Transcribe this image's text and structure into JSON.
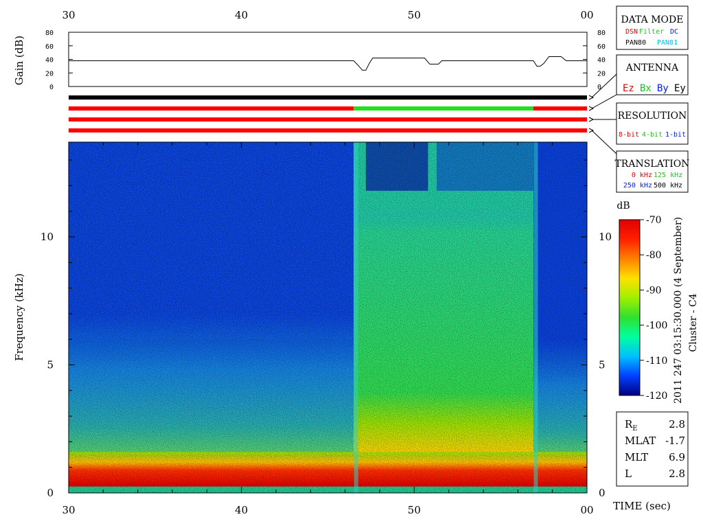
{
  "chart_data": [
    {
      "type": "line",
      "title": "",
      "ylabel": "Gain (dB)",
      "yticks": [
        "0",
        "20",
        "40",
        "60",
        "80"
      ],
      "ylim": [
        0,
        80
      ],
      "xlim": [
        30,
        60
      ],
      "xticks": [
        "30",
        "40",
        "50",
        "00"
      ],
      "series": [
        {
          "x": [
            30,
            46.5,
            46.8,
            47.0,
            47.2,
            47.4,
            47.6,
            50.6,
            50.9,
            51.4,
            51.6,
            56.9,
            57.1,
            57.3,
            57.5,
            57.8,
            58.5,
            58.8,
            60
          ],
          "y": [
            38,
            38,
            30,
            24,
            24,
            34,
            42,
            42,
            33,
            33,
            38,
            38,
            30,
            30,
            34,
            44,
            44,
            38,
            38
          ]
        }
      ]
    },
    {
      "type": "heatmap",
      "xlabel": "TIME (sec)",
      "ylabel": "Frequency (kHz)",
      "xlim": [
        30,
        60
      ],
      "ylim": [
        0,
        13.7
      ],
      "xticks": [
        "30",
        "40",
        "50",
        "00"
      ],
      "yticks": [
        "0",
        "5",
        "10"
      ],
      "colorbar": {
        "label": "dB",
        "range": [
          -120,
          -70
        ],
        "ticks": [
          "-70",
          "-80",
          "-90",
          "-100",
          "-110",
          "-120"
        ],
        "colors": [
          "#000080",
          "#0040ff",
          "#00c0ff",
          "#00ffa0",
          "#30e030",
          "#a0f000",
          "#ffe000",
          "#ff8000",
          "#ff2000",
          "#e00000"
        ]
      },
      "regions": [
        {
          "x": [
            30,
            46.5
          ],
          "background": "#0a40d8",
          "band_top_kHz": 7
        },
        {
          "x": [
            46.5,
            56.9
          ],
          "background": "#20c8a0",
          "band_top_kHz": 11.2
        },
        {
          "x": [
            56.9,
            60
          ],
          "background": "#0a40d8",
          "band_top_kHz": 6
        }
      ]
    }
  ],
  "mode_bars": [
    {
      "segments": [
        {
          "from": 30,
          "to": 60,
          "color": "#000000"
        }
      ]
    },
    {
      "segments": [
        {
          "from": 30,
          "to": 46.5,
          "color": "#ff0000"
        },
        {
          "from": 46.5,
          "to": 56.9,
          "color": "#20e020"
        },
        {
          "from": 56.9,
          "to": 60,
          "color": "#ff0000"
        }
      ]
    },
    {
      "segments": [
        {
          "from": 30,
          "to": 60,
          "color": "#ff0000"
        }
      ]
    },
    {
      "segments": [
        {
          "from": 30,
          "to": 60,
          "color": "#ff0000"
        }
      ]
    }
  ],
  "side_label": "2011 247 03:15:30.000 (4 September)",
  "side_label2": "Cluster - C4",
  "legend": {
    "data_mode": {
      "title": "DATA MODE",
      "items": [
        {
          "text": "DSN",
          "color": "#e00000"
        },
        {
          "text": "Filter",
          "color": "#20c020"
        },
        {
          "text": "DC",
          "color": "#0020e0"
        },
        {
          "text": "PAN80",
          "color": "#000000"
        },
        {
          "text": "PAN81",
          "color": "#00c0e0"
        }
      ]
    },
    "antenna": {
      "title": "ANTENNA",
      "items": [
        {
          "text": "Ez",
          "color": "#e00000"
        },
        {
          "text": "Bx",
          "color": "#20c020"
        },
        {
          "text": "By",
          "color": "#0020e0"
        },
        {
          "text": "Ey",
          "color": "#000000"
        }
      ]
    },
    "resolution": {
      "title": "RESOLUTION",
      "items": [
        {
          "text": "8-bit",
          "color": "#e00000"
        },
        {
          "text": "4-bit",
          "color": "#20c020"
        },
        {
          "text": "1-bit",
          "color": "#0020e0"
        }
      ]
    },
    "translation": {
      "title": "TRANSLATION",
      "items": [
        {
          "text": "0 kHz",
          "color": "#e00000"
        },
        {
          "text": "125 kHz",
          "color": "#20c020"
        },
        {
          "text": "250 kHz",
          "color": "#0020e0"
        },
        {
          "text": "500 kHz",
          "color": "#000000"
        }
      ]
    }
  },
  "info": [
    {
      "label": "R",
      "sub": "E",
      "value": "2.8"
    },
    {
      "label": "MLAT",
      "sub": "",
      "value": "-1.7"
    },
    {
      "label": "MLT",
      "sub": "",
      "value": "6.9"
    },
    {
      "label": "L",
      "sub": "",
      "value": "2.8"
    }
  ]
}
